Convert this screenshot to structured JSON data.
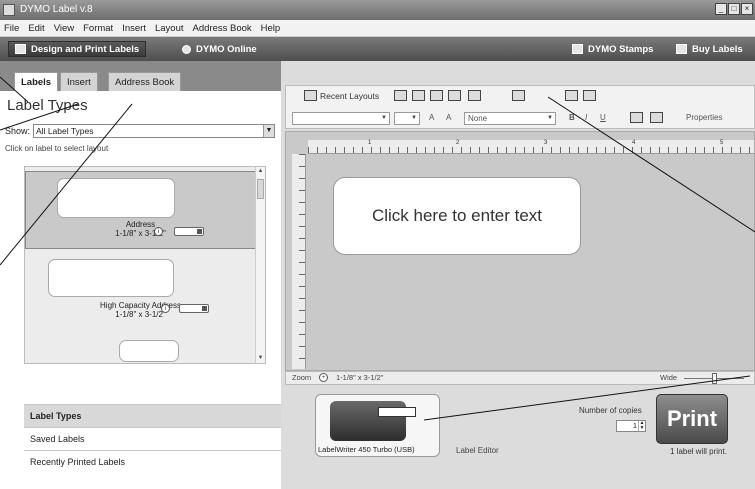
{
  "window": {
    "title": "DYMO Label v.8",
    "minimize": "_",
    "maximize": "□",
    "close": "×"
  },
  "menu": [
    "File",
    "Edit",
    "View",
    "Format",
    "Insert",
    "Layout",
    "Address Book",
    "Help"
  ],
  "top_toolbar": {
    "design_tab": "Design and Print Labels",
    "online_tab": "DYMO Online",
    "stamps": "DYMO Stamps",
    "buy_labels": "Buy Labels"
  },
  "left_tabs": [
    "Labels",
    "Insert",
    "Address Book"
  ],
  "labels_panel": {
    "heading": "Label Types",
    "show_label": "Show:",
    "show_value": "All Label Types",
    "hint": "Click on label to select layout",
    "labels": [
      {
        "name": "Address",
        "size": "1-1/8\" x 3-1/2\""
      },
      {
        "name": "High Capacity Address",
        "size": "1-1/8\" x 3-1/2\""
      },
      {
        "name": "",
        "size": ""
      }
    ],
    "sections": [
      "Label Types",
      "Saved Labels",
      "Recently Printed Labels"
    ]
  },
  "editor": {
    "recent_layouts": "Recent Layouts",
    "font_placeholder": "",
    "size_placeholder": "",
    "style_value": "None",
    "properties": "Properties",
    "label_text": "Click here to enter text",
    "ruler_marks": [
      "1",
      "2",
      "3",
      "4",
      "5"
    ],
    "zoom_label": "Zoom",
    "label_info": "1-1/8\" x 3-1/2\"",
    "width_label": "Wide"
  },
  "printer": {
    "name": "LabelWriter 450 Turbo (USB)",
    "status": "Label Editor",
    "copies_label": "Number of copies",
    "copies_value": "1",
    "print_button": "Print",
    "print_status": "1 label will print."
  },
  "colors": {
    "chrome_dark": "#4e4e4e",
    "panel_bg": "#e8e8e8",
    "canvas_bg": "#c9c9c9"
  },
  "icons": [
    "dymo-app-icon",
    "design-labels-icon",
    "dymo-online-icon",
    "dymo-stamps-icon",
    "buy-labels-icon",
    "recent-layouts-icon",
    "save-icon",
    "print-icon",
    "paste-icon",
    "undo-icon",
    "insert-icon",
    "zoom-icon",
    "text-box-icon",
    "label-roll-icon",
    "info-icon"
  ]
}
